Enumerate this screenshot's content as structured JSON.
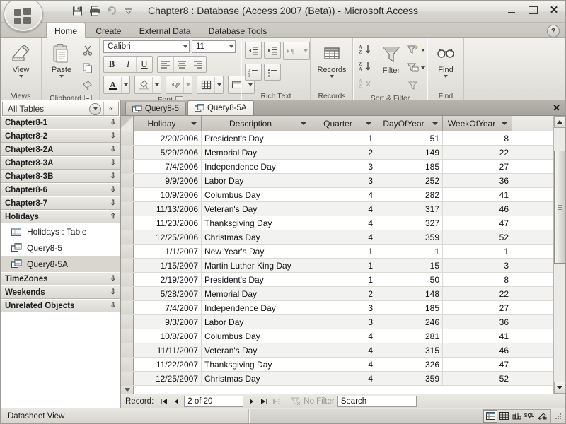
{
  "window": {
    "title": "Chapter8 : Database (Access 2007 (Beta)) - Microsoft Access",
    "minimize_label": "",
    "maximize_label": "",
    "close_label": "✕"
  },
  "quick_access": [
    {
      "name": "save-icon",
      "label": "Save"
    },
    {
      "name": "print-icon",
      "label": "Print"
    },
    {
      "name": "undo-icon",
      "label": "Undo"
    },
    {
      "name": "customize-qat-icon",
      "label": "Customize Quick Access Toolbar"
    }
  ],
  "ribbon": {
    "tabs": [
      {
        "label": "Home",
        "active": true
      },
      {
        "label": "Create",
        "active": false
      },
      {
        "label": "External Data",
        "active": false
      },
      {
        "label": "Database Tools",
        "active": false
      }
    ],
    "help_label": "?",
    "groups": [
      {
        "label": "Views",
        "button": "View",
        "has_dialog_launcher": false
      },
      {
        "label": "Clipboard",
        "button": "Paste",
        "has_dialog_launcher": true,
        "small_buttons": [
          "Cut",
          "Copy",
          "Format Painter"
        ]
      },
      {
        "label": "Font",
        "has_dialog_launcher": true,
        "font_name": "Calibri",
        "font_size": "11",
        "buttons": [
          "Bold",
          "Italic",
          "Underline",
          "Align Left",
          "Center",
          "Align Right",
          "Font Color",
          "Fill Color",
          "Alternate Fill",
          "Gridlines",
          "Datasheet Formatting"
        ]
      },
      {
        "label": "Rich Text",
        "has_dialog_launcher": false,
        "buttons": [
          "Decrease Indent",
          "Increase Indent",
          "Text Direction",
          "Numbered List",
          "Bulleted List"
        ]
      },
      {
        "label": "Records",
        "button": "Records",
        "has_dialog_launcher": false
      },
      {
        "label": "Sort & Filter",
        "button": "Filter",
        "has_dialog_launcher": false,
        "buttons": [
          "Ascending",
          "Descending",
          "Clear All Sorts",
          "Selection",
          "Advanced Filter Options",
          "Toggle Filter"
        ]
      },
      {
        "label": "Find",
        "button": "Find",
        "has_dialog_launcher": false
      }
    ]
  },
  "navpane": {
    "title": "All Tables",
    "collapse_label": "«",
    "groups": [
      {
        "label": "Chapter8-1",
        "expanded": false,
        "items": []
      },
      {
        "label": "Chapter8-2",
        "expanded": false,
        "items": []
      },
      {
        "label": "Chapter8-2A",
        "expanded": false,
        "items": []
      },
      {
        "label": "Chapter8-3A",
        "expanded": false,
        "items": []
      },
      {
        "label": "Chapter8-3B",
        "expanded": false,
        "items": []
      },
      {
        "label": "Chapter8-6",
        "expanded": false,
        "items": []
      },
      {
        "label": "Chapter8-7",
        "expanded": false,
        "items": []
      },
      {
        "label": "Holidays",
        "expanded": true,
        "items": [
          {
            "label": "Holidays : Table",
            "icon": "table-icon",
            "selected": false
          },
          {
            "label": "Query8-5",
            "icon": "query-icon",
            "selected": false
          },
          {
            "label": "Query8-5A",
            "icon": "query-icon",
            "selected": true
          }
        ]
      },
      {
        "label": "TimeZones",
        "expanded": false,
        "items": []
      },
      {
        "label": "Weekends",
        "expanded": false,
        "items": []
      },
      {
        "label": "Unrelated Objects",
        "expanded": false,
        "items": []
      }
    ]
  },
  "doctabs": {
    "tabs": [
      {
        "label": "Query8-5",
        "active": false
      },
      {
        "label": "Query8-5A",
        "active": true
      }
    ],
    "close_label": "✕"
  },
  "datasheet": {
    "columns": [
      "Holiday",
      "Description",
      "Quarter",
      "DayOfYear",
      "WeekOfYear"
    ],
    "rows": [
      [
        "2/20/2006",
        "President's Day",
        "1",
        "51",
        "8"
      ],
      [
        "5/29/2006",
        "Memorial Day",
        "2",
        "149",
        "22"
      ],
      [
        "7/4/2006",
        "Independence Day",
        "3",
        "185",
        "27"
      ],
      [
        "9/9/2006",
        "Labor Day",
        "3",
        "252",
        "36"
      ],
      [
        "10/9/2006",
        "Columbus Day",
        "4",
        "282",
        "41"
      ],
      [
        "11/13/2006",
        "Veteran's Day",
        "4",
        "317",
        "46"
      ],
      [
        "11/23/2006",
        "Thanksgiving Day",
        "4",
        "327",
        "47"
      ],
      [
        "12/25/2006",
        "Christmas Day",
        "4",
        "359",
        "52"
      ],
      [
        "1/1/2007",
        "New Year's Day",
        "1",
        "1",
        "1"
      ],
      [
        "1/15/2007",
        "Martin Luther King Day",
        "1",
        "15",
        "3"
      ],
      [
        "2/19/2007",
        "President's Day",
        "1",
        "50",
        "8"
      ],
      [
        "5/28/2007",
        "Memorial Day",
        "2",
        "148",
        "22"
      ],
      [
        "7/4/2007",
        "Independence Day",
        "3",
        "185",
        "27"
      ],
      [
        "9/3/2007",
        "Labor Day",
        "3",
        "246",
        "36"
      ],
      [
        "10/8/2007",
        "Columbus Day",
        "4",
        "281",
        "41"
      ],
      [
        "11/11/2007",
        "Veteran's Day",
        "4",
        "315",
        "46"
      ],
      [
        "11/22/2007",
        "Thanksgiving Day",
        "4",
        "326",
        "47"
      ],
      [
        "12/25/2007",
        "Christmas Day",
        "4",
        "359",
        "52"
      ]
    ]
  },
  "recordnav": {
    "label": "Record:",
    "first_label": "⏮",
    "prev_label": "◀",
    "position": "2 of 20",
    "next_label": "▶",
    "last_label": "⏭",
    "new_label": "▶*",
    "filter_label": "No Filter",
    "search_placeholder": "Search",
    "search_value": "Search"
  },
  "statusbar": {
    "text": "Datasheet View",
    "view_buttons": [
      {
        "name": "datasheet-view-button",
        "label": "▤",
        "active": true
      },
      {
        "name": "pivottable-view-button",
        "label": "⊞",
        "active": false
      },
      {
        "name": "pivotchart-view-button",
        "label": "◧",
        "active": false
      },
      {
        "name": "sql-view-button",
        "label": "SQL",
        "active": false
      },
      {
        "name": "design-view-button",
        "label": "◤",
        "active": false
      }
    ]
  },
  "colors": {
    "window_bg": "#dedbd4",
    "ribbon_bg": "#e6e4df",
    "grid_alt_row": "#f2f2f0",
    "selection": "#d8d6cf",
    "tab_active": "#fdfdfc"
  }
}
